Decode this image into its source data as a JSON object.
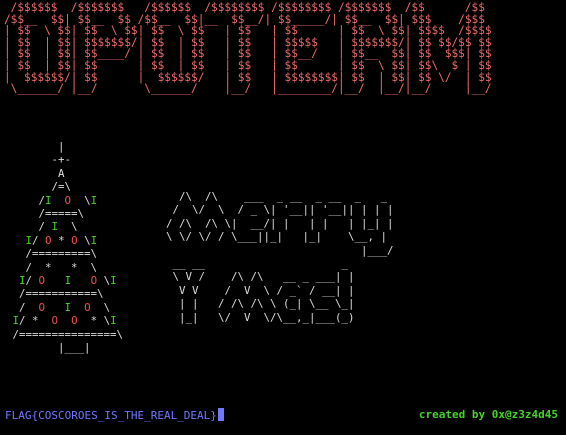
{
  "banner_lines": [
    " /$$$$$$  /$$$$$$$   /$$$$$$  /$$$$$$$$ /$$$$$$$$ /$$$$$$$  /$$      /$$",
    "/$$__  $$| $$__  $$ /$$__  $$|__  $$__/| $$_____/| $$__  $$| $$$    /$$$",
    "| $$  \\ $$| $$  \\ $$| $$  \\ $$   | $$   | $$      | $$  \\ $$| $$$$  /$$$$",
    "| $$  | $$| $$$$$$$/| $$  | $$   | $$   | $$$$$   | $$$$$$$/| $$ $$/$$ $$",
    "| $$  | $$| $$____/ | $$  | $$   | $$   | $$__/   | $$__  $$| $$  $$$| $$",
    "| $$  | $$| $$      | $$  | $$   | $$   | $$      | $$  \\ $$| $$\\  $ | $$",
    "|  $$$$$$/| $$      |  $$$$$$/   | $$   | $$$$$$$$| $$  | $$| $$ \\/  | $$",
    " \\______/ |__/       \\______/    |__/   |________/|__/  |__/|__/     |__/"
  ],
  "tree_lines": [
    "        |",
    "       -+-",
    "        A",
    "       /=\\",
    "     /I  O  \\I",
    "     /=====\\",
    "     / I  \\",
    "   I/ O * O \\I",
    "   /=========\\",
    "   /  *   *  \\",
    "  I/ O   I   O \\I",
    "  /===========\\",
    "  /  O   I  O  \\",
    " I/ *  O  O  * \\I",
    " /===============\\",
    "        |___|"
  ],
  "greeting_lines": [
    "  /\\  /\\    ___  _ __  _ __  _   _",
    " /  \\/  \\  / _ \\| '__|| '__|| | | |",
    "/ /\\  /\\ \\|  __/| |   | |   | |_| |",
    "\\ \\/ \\/ / \\___||_|   |_|    \\__, |",
    "                              |___/",
    " __ __                     _",
    " \\ V /    /\\ /\\   __ _ ___| |",
    "  V V    /  V  \\ / _` / __| |",
    "  | |   / /\\ /\\ \\ (_| \\__ \\_|",
    "  |_|   \\/  V  \\/\\__,_|___(_)"
  ],
  "flag_text": "FLAG{COSCOROES_IS_THE_REAL_DEAL}",
  "credit_text": "created by 0x@z3z4d45",
  "colors": {
    "background": "#000000",
    "banner": "#ef6b6b",
    "banner_highlight": "#eaeaea",
    "ascii_text": "#dcdcdc",
    "ornament_green": "#46d22a",
    "ornament_red": "#ef4f4f",
    "flag": "#6f78ff",
    "credit": "#46d22a"
  }
}
